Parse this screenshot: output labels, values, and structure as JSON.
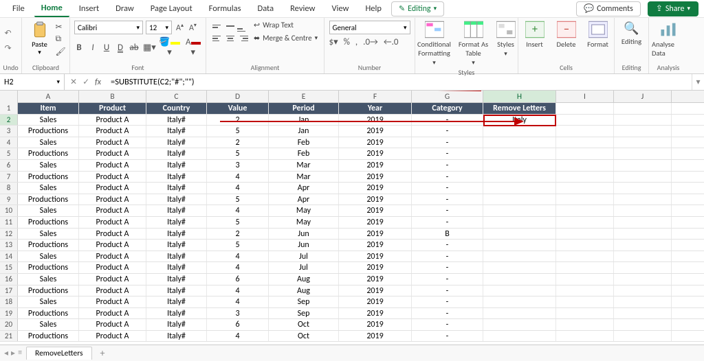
{
  "menu": {
    "tabs": [
      "File",
      "Home",
      "Insert",
      "Draw",
      "Page Layout",
      "Formulas",
      "Data",
      "Review",
      "View",
      "Help"
    ],
    "active": "Home",
    "editing": "Editing",
    "comments": "Comments",
    "share": "Share"
  },
  "ribbon": {
    "groups": {
      "undo": "Undo",
      "clipboard": "Clipboard",
      "font": "Font",
      "alignment": "Alignment",
      "number": "Number",
      "styles": "Styles",
      "cells": "Cells",
      "editing": "Editing",
      "analysis": "Analysis"
    },
    "paste": "Paste",
    "font_name": "Calibri",
    "font_size": "12",
    "wrap": "Wrap Text",
    "merge": "Merge & Centre",
    "num_format": "General",
    "cond_fmt": "Conditional Formatting",
    "fmt_table": "Format As Table",
    "styles_btn": "Styles",
    "insert": "Insert",
    "delete": "Delete",
    "format": "Format",
    "editing_btn": "Editing",
    "analyse": "Analyse Data"
  },
  "namebox": "H2",
  "formula": "=SUBSTITUTE(C2;\"#\";\"\")",
  "cols": [
    "A",
    "B",
    "C",
    "D",
    "E",
    "F",
    "G",
    "H",
    "I",
    "J"
  ],
  "headers": [
    "Item",
    "Product",
    "Country",
    "Value",
    "Period",
    "Year",
    "Category",
    "Remove Letters"
  ],
  "rows": [
    {
      "n": 2,
      "d": [
        "Sales",
        "Product A",
        "Italy#",
        "2",
        "Jan",
        "2019",
        "-",
        "Italy"
      ]
    },
    {
      "n": 3,
      "d": [
        "Productions",
        "Product A",
        "Italy#",
        "5",
        "Jan",
        "2019",
        "-",
        ""
      ]
    },
    {
      "n": 4,
      "d": [
        "Sales",
        "Product A",
        "Italy#",
        "2",
        "Feb",
        "2019",
        "-",
        ""
      ]
    },
    {
      "n": 5,
      "d": [
        "Productions",
        "Product A",
        "Italy#",
        "5",
        "Feb",
        "2019",
        "-",
        ""
      ]
    },
    {
      "n": 6,
      "d": [
        "Sales",
        "Product A",
        "Italy#",
        "3",
        "Mar",
        "2019",
        "-",
        ""
      ]
    },
    {
      "n": 7,
      "d": [
        "Productions",
        "Product A",
        "Italy#",
        "4",
        "Mar",
        "2019",
        "-",
        ""
      ]
    },
    {
      "n": 8,
      "d": [
        "Sales",
        "Product A",
        "Italy#",
        "4",
        "Apr",
        "2019",
        "-",
        ""
      ]
    },
    {
      "n": 9,
      "d": [
        "Productions",
        "Product A",
        "Italy#",
        "5",
        "Apr",
        "2019",
        "-",
        ""
      ]
    },
    {
      "n": 10,
      "d": [
        "Sales",
        "Product A",
        "Italy#",
        "4",
        "May",
        "2019",
        "-",
        ""
      ]
    },
    {
      "n": 11,
      "d": [
        "Productions",
        "Product A",
        "Italy#",
        "5",
        "May",
        "2019",
        "-",
        ""
      ]
    },
    {
      "n": 12,
      "d": [
        "Sales",
        "Product A",
        "Italy#",
        "2",
        "Jun",
        "2019",
        "B",
        ""
      ]
    },
    {
      "n": 13,
      "d": [
        "Productions",
        "Product A",
        "Italy#",
        "5",
        "Jun",
        "2019",
        "-",
        ""
      ]
    },
    {
      "n": 14,
      "d": [
        "Sales",
        "Product A",
        "Italy#",
        "4",
        "Jul",
        "2019",
        "-",
        ""
      ]
    },
    {
      "n": 15,
      "d": [
        "Productions",
        "Product A",
        "Italy#",
        "4",
        "Jul",
        "2019",
        "-",
        ""
      ]
    },
    {
      "n": 16,
      "d": [
        "Sales",
        "Product A",
        "Italy#",
        "6",
        "Aug",
        "2019",
        "-",
        ""
      ]
    },
    {
      "n": 17,
      "d": [
        "Productions",
        "Product A",
        "Italy#",
        "4",
        "Aug",
        "2019",
        "-",
        ""
      ]
    },
    {
      "n": 18,
      "d": [
        "Sales",
        "Product A",
        "Italy#",
        "4",
        "Sep",
        "2019",
        "-",
        ""
      ]
    },
    {
      "n": 19,
      "d": [
        "Productions",
        "Product A",
        "Italy#",
        "3",
        "Sep",
        "2019",
        "-",
        ""
      ]
    },
    {
      "n": 20,
      "d": [
        "Sales",
        "Product A",
        "Italy#",
        "6",
        "Oct",
        "2019",
        "-",
        ""
      ]
    },
    {
      "n": 21,
      "d": [
        "Productions",
        "Product A",
        "Italy#",
        "4",
        "Oct",
        "2019",
        "-",
        ""
      ]
    }
  ],
  "active_col": "H",
  "active_row": 2,
  "sheet": {
    "name": "RemoveLetters"
  },
  "colors": {
    "accent": "#107c41",
    "header": "#44546a",
    "arrow": "#c00000"
  }
}
